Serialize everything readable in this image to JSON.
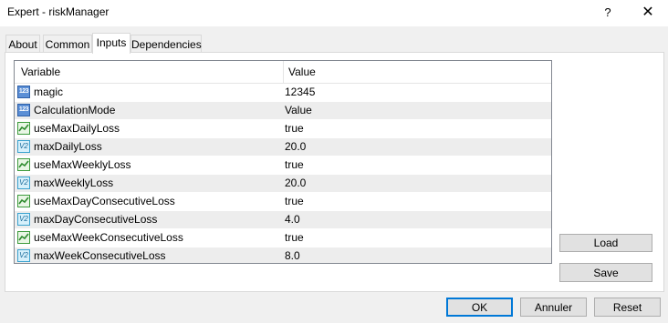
{
  "window": {
    "title": "Expert - riskManager",
    "help": "?",
    "close": "✕"
  },
  "tabs": [
    {
      "label": "About"
    },
    {
      "label": "Common"
    },
    {
      "label": "Inputs"
    },
    {
      "label": "Dependencies"
    }
  ],
  "active_tab": "Inputs",
  "grid": {
    "headers": {
      "variable": "Variable",
      "value": "Value"
    },
    "rows": [
      {
        "icon": "int-icon",
        "name": "magic",
        "value": "12345"
      },
      {
        "icon": "int-icon",
        "name": "CalculationMode",
        "value": "Value"
      },
      {
        "icon": "bool-icon",
        "name": "useMaxDailyLoss",
        "value": "true"
      },
      {
        "icon": "double-icon",
        "name": "maxDailyLoss",
        "value": "20.0"
      },
      {
        "icon": "bool-icon",
        "name": "useMaxWeeklyLoss",
        "value": "true"
      },
      {
        "icon": "double-icon",
        "name": "maxWeeklyLoss",
        "value": "20.0"
      },
      {
        "icon": "bool-icon",
        "name": "useMaxDayConsecutiveLoss",
        "value": "true"
      },
      {
        "icon": "double-icon",
        "name": "maxDayConsecutiveLoss",
        "value": "4.0"
      },
      {
        "icon": "bool-icon",
        "name": "useMaxWeekConsecutiveLoss",
        "value": "true"
      },
      {
        "icon": "double-icon",
        "name": "maxWeekConsecutiveLoss",
        "value": "8.0"
      }
    ]
  },
  "side_buttons": {
    "load": "Load",
    "save": "Save"
  },
  "footer": {
    "ok": "OK",
    "cancel": "Annuler",
    "reset": "Reset"
  },
  "colors": {
    "accent": "#0078d7",
    "alt_row": "#ededed"
  }
}
